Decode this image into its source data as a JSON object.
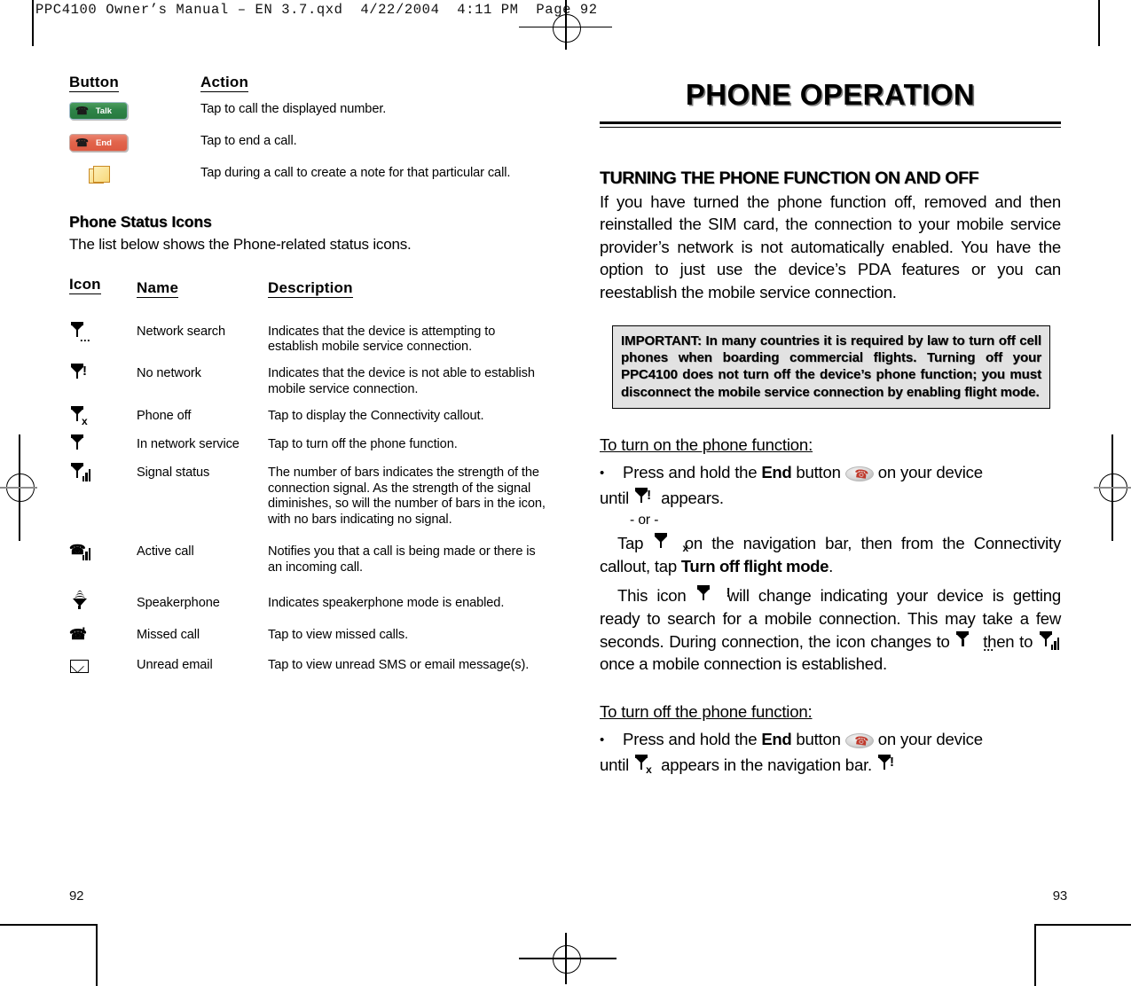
{
  "prepress": {
    "header_line": "PPC4100 Owner’s Manual – EN 3.7.qxd  4/22/2004  4:11 PM  Page 92"
  },
  "left_page": {
    "folio": "92",
    "button_table": {
      "headers": {
        "button": "Button",
        "action": "Action"
      },
      "rows": [
        {
          "icon": "talk-button-icon",
          "icon_label": "Talk",
          "action": "Tap to call the displayed number."
        },
        {
          "icon": "end-button-icon",
          "icon_label": "End",
          "action": "Tap to end a call."
        },
        {
          "icon": "note-icon",
          "icon_label": "",
          "action": "Tap during a call to create a note for that particular call."
        }
      ]
    },
    "status_section": {
      "heading": "Phone Status Icons",
      "lead": "The list below shows the Phone-related status icons."
    },
    "icon_table": {
      "headers": {
        "icon": "Icon",
        "name": "Name",
        "description": "Description"
      },
      "rows": [
        {
          "icon": "antenna-dots-icon",
          "name": "Network search",
          "description": "Indicates that the device is attempting  to establish mobile service connection."
        },
        {
          "icon": "antenna-exclamation-icon",
          "name": "No network",
          "description": "Indicates that the device is not able to establish mobile service connection."
        },
        {
          "icon": "antenna-x-icon",
          "name": "Phone off",
          "description": "Tap to display the Connectivity callout."
        },
        {
          "icon": "antenna-icon",
          "name": "In network service",
          "description": "Tap to turn off the phone function."
        },
        {
          "icon": "antenna-bars-icon",
          "name": "Signal status",
          "description": "The number of bars indicates  the strength of the connection signal. As the strength of the signal diminishes, so will the number of bars in the icon, with no bars indicating no signal."
        },
        {
          "icon": "active-call-icon",
          "name": "Active call",
          "description": "Notifies you that a call is being made or there is an incoming call."
        },
        {
          "icon": "speakerphone-icon",
          "name": "Speakerphone",
          "description": "Indicates speakerphone mode is enabled."
        },
        {
          "icon": "missed-call-icon",
          "name": "Missed call",
          "description": "Tap to view missed calls."
        },
        {
          "icon": "unread-email-icon",
          "name": "Unread email",
          "description": "Tap to view unread SMS or email message(s)."
        }
      ]
    }
  },
  "right_page": {
    "folio": "93",
    "chapter_title": "PHONE OPERATION",
    "section_heading": "TURNING THE PHONE FUNCTION ON AND OFF",
    "intro_paragraph": "If you have turned the phone function off, removed and then reinstalled the SIM card, the connection to your mobile service provider’s network is not automatically enabled. You have the option to just use the device’s PDA features or you can reestablish the mobile service connection.",
    "important_note": "IMPORTANT: In many countries it is required by law to turn off cell phones when boarding commercial flights. Turning off your PPC4100 does not turn off the device’s phone function; you must disconnect the mobile service connection by enabling flight mode.",
    "turn_on": {
      "heading": "To turn on the phone function:",
      "bullet_pre": "Press and hold the",
      "bullet_keyword": "End",
      "bullet_mid": "button",
      "bullet_post": "on your device",
      "until_pre": "until",
      "until_post": "appears.",
      "or_text": "- or -",
      "alt_pre": "Tap",
      "alt_mid": "on the navigation bar, then from the Connectivity callout, tap",
      "alt_keyword": "Turn off flight mode",
      "alt_post": ".",
      "result_pre": "This icon",
      "result_mid": "will change indicating your device is getting ready to search for a mobile connection. This may take a few seconds. During connection, the icon",
      "result_changes_to": "changes to",
      "result_then_to": "then to",
      "result_end": "once a mobile connection is established."
    },
    "turn_off": {
      "heading": "To turn off the phone function:",
      "bullet_pre": "Press and hold the",
      "bullet_keyword": "End",
      "bullet_mid": "button",
      "bullet_post": "on your device",
      "until_pre": "until",
      "until_post": "appears in the navigation bar."
    }
  },
  "colors": {
    "talk_button": "#2e8348",
    "end_button": "#e2654c",
    "note_icon": "#f8d87a",
    "important_box_bg": "#e2e2e2",
    "ink": "#000000"
  }
}
